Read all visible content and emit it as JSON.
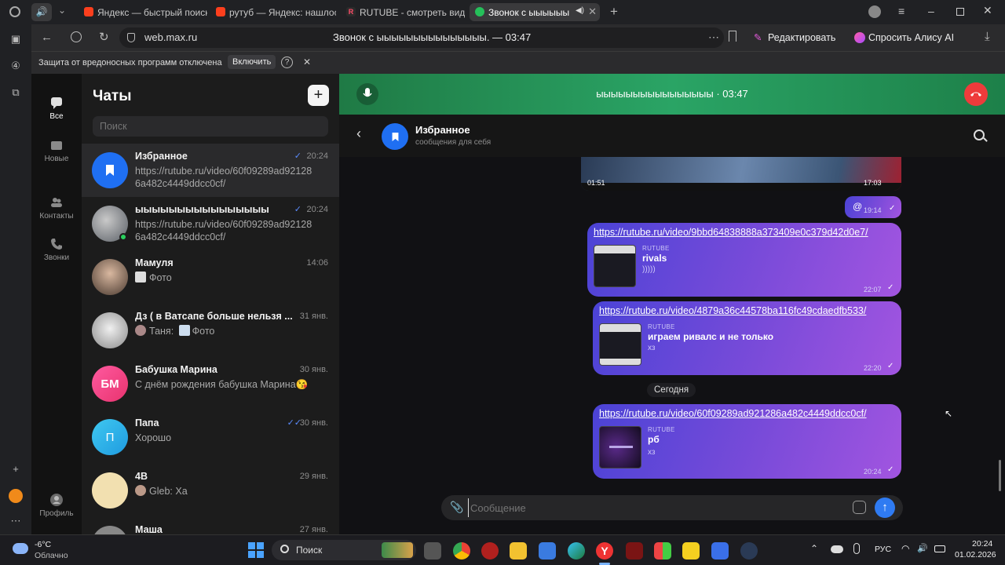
{
  "browser": {
    "tabs": [
      {
        "title": "Яндекс — быстрый поиск",
        "color": "#fc3f1d"
      },
      {
        "title": "рутуб — Яндекс: нашлось",
        "color": "#fc3f1d"
      },
      {
        "title": "RUTUBE - смотреть видео",
        "color": "#ffffff"
      },
      {
        "title": "Звонок с ыыыыыы",
        "color": "#25c05a"
      }
    ],
    "url": "web.max.ru",
    "page_title": "Звонок с ыыыыыыыыыыыыыыы. — 03:47",
    "edit_label": "Редактировать",
    "alice_label": "Спросить Алису AI",
    "security_warning": "Защита от вредоносных программ отключена",
    "enable_label": "Включить"
  },
  "nav": {
    "all": "Все",
    "new": "Новые",
    "contacts": "Контакты",
    "calls": "Звонки",
    "profile": "Профиль"
  },
  "chats": {
    "title": "Чаты",
    "search_placeholder": "Поиск",
    "items": [
      {
        "name": "Избранное",
        "time": "20:24",
        "preview": "https://rutube.ru/video/60f09289ad92128 6a482c4449ddcc0cf/",
        "avatar_color": "#1f6ff2",
        "initials": ""
      },
      {
        "name": "ыыыыыыыыыыыыыыыы",
        "time": "20:24",
        "preview": "https://rutube.ru/video/60f09289ad92128 6a482c4449ddcc0cf/",
        "avatar_color": "#7a7f86",
        "initials": ""
      },
      {
        "name": "Мамуля",
        "time": "14:06",
        "preview": "Фото",
        "avatar_color": "#8a6a5a",
        "initials": ""
      },
      {
        "name": "Дз ( в Ватсапе больше нельзя ...",
        "time": "31 янв.",
        "preview_sender": "Таня:",
        "preview": "Фото",
        "avatar_color": "#c9c9c9",
        "initials": ""
      },
      {
        "name": "Бабушка Марина",
        "time": "30 янв.",
        "preview": "С днём рождения бабушка Марина😘",
        "avatar_color": "#e8418a",
        "initials": "БМ"
      },
      {
        "name": "Папа",
        "time": "30 янв.",
        "preview": "Хорошо",
        "avatar_color": "#2fb3e8",
        "initials": "П"
      },
      {
        "name": "4В",
        "time": "29 янв.",
        "preview_sender": "Gleb:",
        "preview": "Ха",
        "avatar_color": "#f2e0b0",
        "initials": ""
      },
      {
        "name": "Маша",
        "time": "27 янв.",
        "preview": "",
        "avatar_color": "#888888",
        "initials": ""
      }
    ]
  },
  "call": {
    "title": "ыыыыыыыыыыыыыыыы · 03:47"
  },
  "chat": {
    "name": "Избранное",
    "subtitle": "сообщения для себя",
    "top_video": {
      "left_time": "01:51",
      "right_time": "17:03"
    },
    "small_msg": {
      "text": "@",
      "time": "19:14"
    },
    "messages": [
      {
        "link": "https://rutube.ru/video/9bbd64838888a373409e0c379d42d0e7/",
        "source": "RUTUBE",
        "title": "rivals",
        "desc": ")))))",
        "time": "22:07"
      },
      {
        "link": "https://rutube.ru/video/4879a36c44578ba116fc49cdaedfb533/",
        "source": "RUTUBE",
        "title": "играем ривалс и не только",
        "desc": "хз",
        "time": "22:20"
      },
      {
        "link": "https://rutube.ru/video/60f09289ad921286a482c4449ddcc0cf/",
        "source": "RUTUBE",
        "title": "рб",
        "desc": "хз",
        "time": "20:24"
      }
    ],
    "date_separator": "Сегодня",
    "input_placeholder": "Сообщение"
  },
  "taskbar": {
    "weather_temp": "-6°C",
    "weather_desc": "Облачно",
    "search_label": "Поиск",
    "lang": "РУС",
    "time": "20:24",
    "date": "01.02.2026"
  }
}
